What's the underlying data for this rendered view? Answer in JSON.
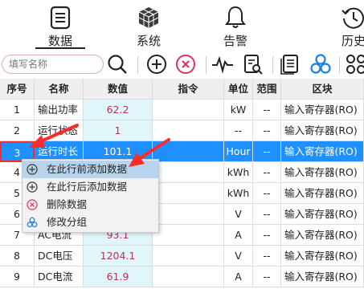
{
  "nav": {
    "tabs": [
      {
        "label": "数据",
        "icon": "list-icon",
        "active": true
      },
      {
        "label": "系统",
        "icon": "cube-icon"
      },
      {
        "label": "告警",
        "icon": "bell-icon"
      },
      {
        "label": "历史",
        "icon": "history-icon"
      }
    ]
  },
  "toolbar": {
    "search_placeholder": "填写名称",
    "icons": [
      "search-icon",
      "add-icon",
      "delete-icon",
      "waveform-icon",
      "report-icon",
      "document-icon",
      "group-icon",
      "more-icon"
    ]
  },
  "table": {
    "headers": {
      "index": "序号",
      "name": "名称",
      "value": "数值",
      "command": "指令",
      "unit": "单位",
      "range": "范围",
      "block": "区块"
    },
    "rows": [
      {
        "index": "1",
        "name": "输出功率",
        "value": "62.2",
        "command": "",
        "unit": "kW",
        "range": "--",
        "block": "输入寄存器(RO)"
      },
      {
        "index": "2",
        "name": "运行状态",
        "value": "1",
        "command": "",
        "unit": "--",
        "range": "--",
        "block": "输入寄存器(RO)"
      },
      {
        "index": "3",
        "name": "运行时长",
        "value": "101.1",
        "command": "",
        "unit": "Hour",
        "range": "--",
        "block": "输入寄存器(RO)",
        "highlighted": true
      },
      {
        "index": "4",
        "name": "",
        "value": "",
        "command": "",
        "unit": "kWh",
        "range": "--",
        "block": "输入寄存器(RO)"
      },
      {
        "index": "5",
        "name": "",
        "value": "",
        "command": "",
        "unit": "kWh",
        "range": "--",
        "block": "输入寄存器(RO)"
      },
      {
        "index": "6",
        "name": "",
        "value": "",
        "command": "",
        "unit": "V",
        "range": "--",
        "block": "输入寄存器(RO)"
      },
      {
        "index": "7",
        "name": "AC电流",
        "value": "93.1",
        "command": "",
        "unit": "A",
        "range": "--",
        "block": "输入寄存器(RO)"
      },
      {
        "index": "8",
        "name": "DC电压",
        "value": "1204.1",
        "command": "",
        "unit": "V",
        "range": "--",
        "block": "输入寄存器(RO)"
      },
      {
        "index": "9",
        "name": "DC电流",
        "value": "61.9",
        "command": "",
        "unit": "A",
        "range": "--",
        "block": "输入寄存器(RO)"
      }
    ]
  },
  "context_menu": {
    "items": [
      {
        "label": "在此行前添加数据",
        "icon": "add-icon",
        "active": true
      },
      {
        "label": "在此行后添加数据",
        "icon": "add-icon"
      },
      {
        "label": "删除数据",
        "icon": "delete-icon"
      },
      {
        "label": "修改分组",
        "icon": "group-icon"
      }
    ]
  },
  "colors": {
    "highlight_row": "#1e90ff",
    "value_cell_bg": "#e0f6fb",
    "value_text": "#b0306a",
    "menu_active": "#b7d4ec",
    "annotation_red": "#ff2b2b"
  }
}
